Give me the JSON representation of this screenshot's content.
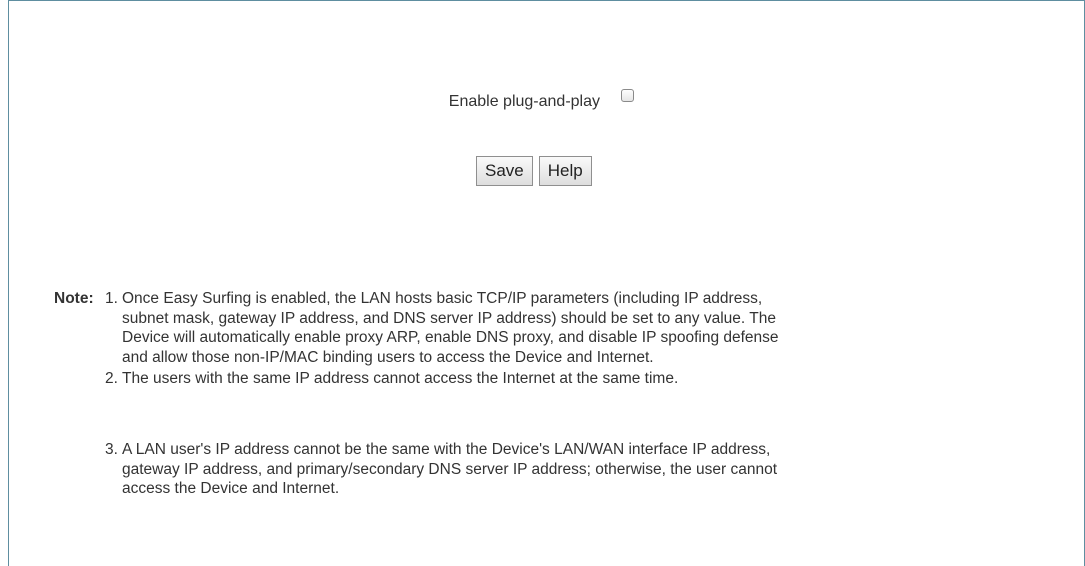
{
  "form": {
    "enable_label": "Enable plug-and-play",
    "enable_checked": false,
    "save_label": "Save",
    "help_label": "Help"
  },
  "note": {
    "label": "Note:",
    "items": [
      {
        "num": "1.",
        "lines": [
          "Once Easy Surfing is enabled, the LAN hosts basic TCP/IP parameters (including IP address,",
          "subnet mask, gateway IP address, and DNS server IP address) should be set to any value. The",
          "Device will automatically enable proxy ARP, enable DNS proxy, and disable IP spoofing defense",
          "and allow those non-IP/MAC binding users to access the Device and Internet."
        ]
      },
      {
        "num": "2.",
        "lines": [
          "The users with the same IP address cannot access the Internet at the same time."
        ]
      },
      {
        "num": "3.",
        "lines": [
          "A LAN user's IP address cannot be the same with the Device's LAN/WAN interface IP address,",
          "gateway IP address, and primary/secondary DNS server IP address; otherwise, the user cannot",
          "access the Device and Internet."
        ]
      }
    ]
  }
}
